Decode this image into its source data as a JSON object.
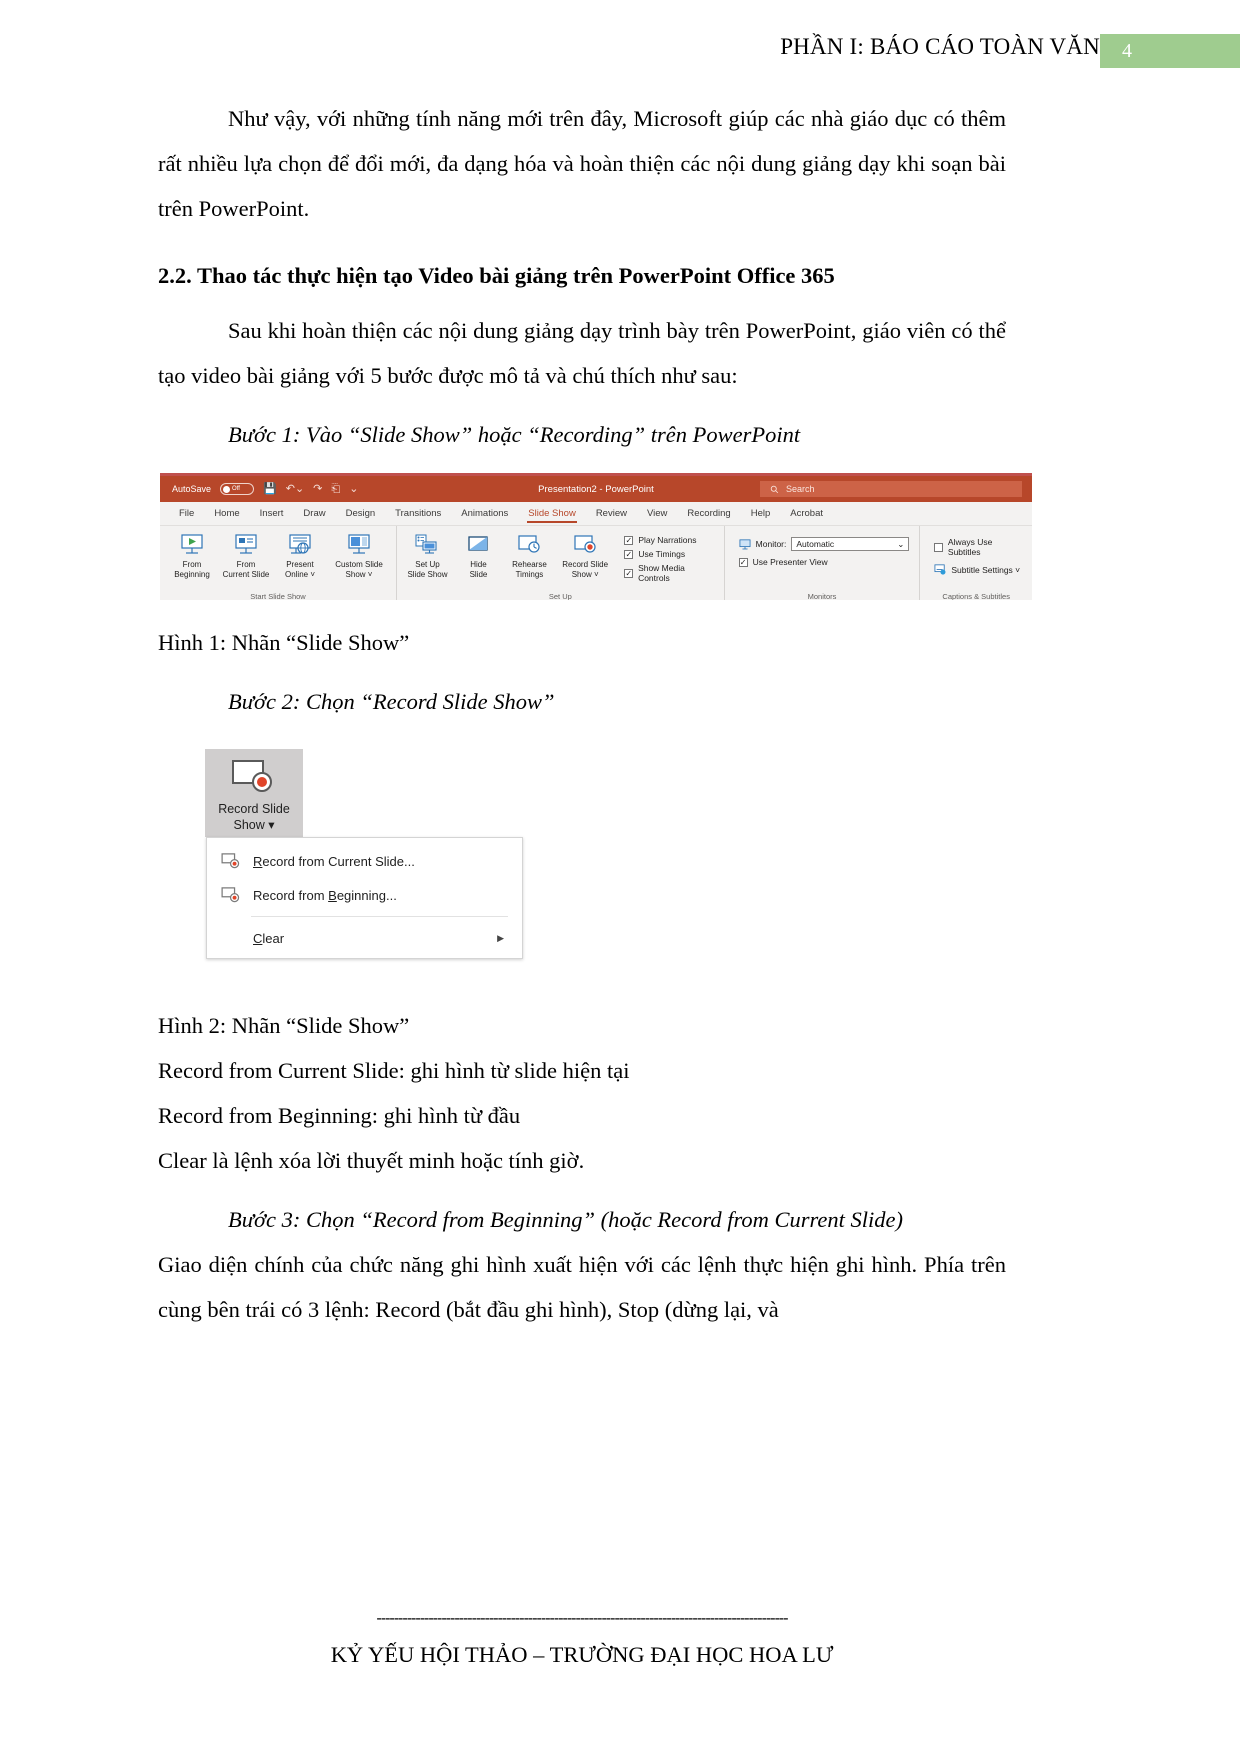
{
  "header": {
    "title": "PHẦN I: BÁO CÁO TOÀN VĂN",
    "page_number": "4",
    "badge_color": "#9fcc8f"
  },
  "body": {
    "para1": "Như vậy, với những tính năng mới trên đây, Microsoft giúp các nhà giáo dục có thêm rất nhiều lựa chọn để đổi mới, đa dạng hóa và hoàn thiện các nội dung giảng dạy khi soạn bài trên PowerPoint.",
    "heading2": "2.2. Thao tác thực hiện tạo Video bài giảng trên PowerPoint Office 365",
    "para2": "Sau khi hoàn thiện các nội dung giảng dạy trình bày trên PowerPoint, giáo viên có thể tạo video bài giảng với 5 bước được mô tả và chú thích như sau:",
    "step1": "Bước 1: Vào “Slide Show” hoặc “Recording” trên PowerPoint",
    "caption1": "Hình 1: Nhãn “Slide Show”",
    "step2": "Bước 2: Chọn “Record Slide Show”",
    "caption2": "Hình 2: Nhãn “Slide Show”",
    "note1": "Record from Current Slide: ghi hình từ slide hiện tại",
    "note2": "Record from Beginning: ghi hình từ đầu",
    "note3": "Clear là lệnh xóa lời thuyết minh hoặc tính giờ.",
    "step3": "Bước 3: Chọn “Record from Beginning” (hoặc Record from Current Slide)",
    "para3": "Giao diện chính của chức năng ghi hình xuất hiện với các lệnh thực hiện ghi hình. Phía trên cùng bên trái có 3 lệnh: Record (bắt đầu ghi hình), Stop (dừng lại, và"
  },
  "footer": {
    "rule": "-----------------------------------------------------------------------------------------------",
    "text": "KỶ YẾU HỘI THẢO – TRƯỜNG ĐẠI HỌC HOA LƯ"
  },
  "figure1": {
    "titlebar": {
      "autosave_label": "AutoSave",
      "toggle_state": "Off",
      "quick_access": [
        "save-icon",
        "undo-icon",
        "redo-icon",
        "start-from-beginning-icon",
        "customize-qat-icon"
      ],
      "document_title": "Presentation2 - PowerPoint",
      "search_placeholder": "Search"
    },
    "tabs": [
      {
        "label": "File",
        "active": false
      },
      {
        "label": "Home",
        "active": false
      },
      {
        "label": "Insert",
        "active": false
      },
      {
        "label": "Draw",
        "active": false
      },
      {
        "label": "Design",
        "active": false
      },
      {
        "label": "Transitions",
        "active": false
      },
      {
        "label": "Animations",
        "active": false
      },
      {
        "label": "Slide Show",
        "active": true
      },
      {
        "label": "Review",
        "active": false
      },
      {
        "label": "View",
        "active": false
      },
      {
        "label": "Recording",
        "active": false
      },
      {
        "label": "Help",
        "active": false
      },
      {
        "label": "Acrobat",
        "active": false
      }
    ],
    "groups": {
      "start_slide_show": {
        "label": "Start Slide Show",
        "buttons": [
          {
            "line1": "From",
            "line2": "Beginning"
          },
          {
            "line1": "From",
            "line2": "Current Slide"
          },
          {
            "line1": "Present",
            "line2": "Online ˅"
          },
          {
            "line1": "Custom Slide",
            "line2": "Show ˅"
          }
        ]
      },
      "set_up": {
        "label": "Set Up",
        "buttons": [
          {
            "line1": "Set Up",
            "line2": "Slide Show"
          },
          {
            "line1": "Hide",
            "line2": "Slide"
          },
          {
            "line1": "Rehearse",
            "line2": "Timings"
          },
          {
            "line1": "Record Slide",
            "line2": "Show ˅"
          }
        ],
        "checkboxes": [
          {
            "label": "Play Narrations",
            "checked": true
          },
          {
            "label": "Use Timings",
            "checked": true
          },
          {
            "label": "Show Media Controls",
            "checked": true
          }
        ]
      },
      "monitors": {
        "label": "Monitors",
        "monitor_label": "Monitor:",
        "monitor_value": "Automatic",
        "presenter_view": {
          "label": "Use Presenter View",
          "checked": true
        }
      },
      "captions": {
        "label": "Captions & Subtitles",
        "always_use_subtitles": {
          "label": "Always Use Subtitles",
          "checked": false
        },
        "subtitle_settings": "Subtitle Settings ˅"
      }
    },
    "accent_color": "#b7472a"
  },
  "figure2": {
    "button": {
      "line1": "Record Slide",
      "line2": "Show ▾"
    },
    "menu_items": [
      {
        "prefix": "R",
        "rest": "ecord from Current Slide...",
        "underline": "R",
        "has_icon": true,
        "has_submenu": false
      },
      {
        "prefix": "Record from ",
        "rest": "Beginning...",
        "underline": "B",
        "has_icon": true,
        "has_submenu": false
      },
      {
        "prefix": "C",
        "rest": "lear",
        "underline": "C",
        "has_icon": false,
        "has_submenu": true
      }
    ]
  }
}
